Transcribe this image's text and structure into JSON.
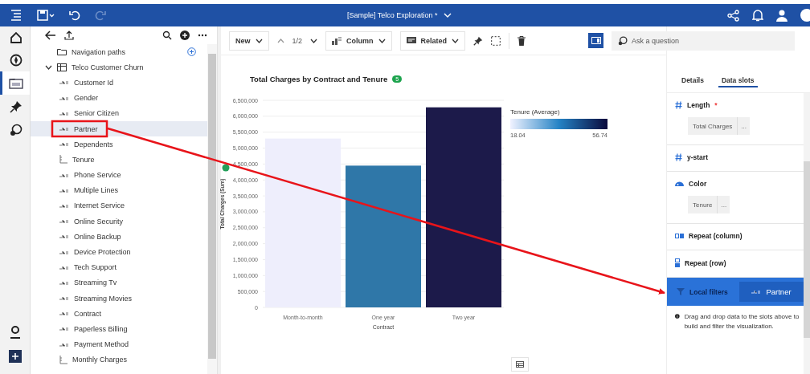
{
  "top_bar": {
    "title": "[Sample] Telco Exploration *"
  },
  "rail": [
    {
      "kind": "home",
      "selected": false
    },
    {
      "kind": "explore",
      "selected": false
    },
    {
      "kind": "data",
      "selected": true
    },
    {
      "kind": "pin",
      "selected": false
    },
    {
      "kind": "assistant",
      "selected": false
    }
  ],
  "tree": {
    "items": [
      {
        "label": "Navigation paths",
        "kind": "folder",
        "selected": false
      },
      {
        "label": "Telco Customer Churn",
        "kind": "table",
        "expanded": true,
        "selected": false,
        "children": [
          {
            "label": "Customer Id",
            "kind": "text",
            "selected": false
          },
          {
            "label": "Gender",
            "kind": "text",
            "selected": false
          },
          {
            "label": "Senior Citizen",
            "kind": "text",
            "selected": false
          },
          {
            "label": "Partner",
            "kind": "text",
            "selected": true
          },
          {
            "label": "Dependents",
            "kind": "text",
            "selected": false
          },
          {
            "label": "Tenure",
            "kind": "measure",
            "selected": false
          },
          {
            "label": "Phone Service",
            "kind": "text",
            "selected": false
          },
          {
            "label": "Multiple Lines",
            "kind": "text",
            "selected": false
          },
          {
            "label": "Internet Service",
            "kind": "text",
            "selected": false
          },
          {
            "label": "Online Security",
            "kind": "text",
            "selected": false
          },
          {
            "label": "Online Backup",
            "kind": "text",
            "selected": false
          },
          {
            "label": "Device Protection",
            "kind": "text",
            "selected": false
          },
          {
            "label": "Tech Support",
            "kind": "text",
            "selected": false
          },
          {
            "label": "Streaming Tv",
            "kind": "text",
            "selected": false
          },
          {
            "label": "Streaming Movies",
            "kind": "text",
            "selected": false
          },
          {
            "label": "Contract",
            "kind": "text",
            "selected": false
          },
          {
            "label": "Paperless Billing",
            "kind": "text",
            "selected": false
          },
          {
            "label": "Payment Method",
            "kind": "text",
            "selected": false
          },
          {
            "label": "Monthly Charges",
            "kind": "measure",
            "selected": false
          }
        ]
      }
    ]
  },
  "toolbar": {
    "new": "New",
    "page": "1/2",
    "visualization": "Column",
    "related": "Related",
    "ask": "Ask a question"
  },
  "chart": {
    "title": "Total Charges by Contract and Tenure",
    "badge": "5",
    "legend": {
      "title": "Tenure (Average)",
      "min": "18.04",
      "max": "56.74"
    },
    "chart_data": {
      "type": "bar",
      "xlabel": "Contract",
      "ylabel": "Total Charges (Sum)",
      "categories": [
        "Month-to-month",
        "One year",
        "Two year"
      ],
      "values": [
        5300000,
        4450000,
        6280000
      ],
      "grid": true,
      "ylim": [
        0,
        6500000
      ],
      "yticks": [
        {
          "value": 0,
          "label": "0"
        },
        {
          "value": 500000,
          "label": "500,000"
        },
        {
          "value": 1000000,
          "label": "1,000,000"
        },
        {
          "value": 1500000,
          "label": "1,500,000"
        },
        {
          "value": 2000000,
          "label": "2,000,000"
        },
        {
          "value": 2500000,
          "label": "2,500,000"
        },
        {
          "value": 3000000,
          "label": "3,000,000"
        },
        {
          "value": 3500000,
          "label": "3,500,000"
        },
        {
          "value": 4000000,
          "label": "4,000,000"
        },
        {
          "value": 4500000,
          "label": "4,500,000"
        },
        {
          "value": 5000000,
          "label": "5,000,000"
        },
        {
          "value": 5500000,
          "label": "5,500,000"
        },
        {
          "value": 6000000,
          "label": "6,000,000"
        },
        {
          "value": 6500000,
          "label": "6,500,000"
        }
      ]
    }
  },
  "panel": {
    "tabs": [
      {
        "label": "Details",
        "selected": false
      },
      {
        "label": "Data slots",
        "selected": true
      }
    ],
    "slots": [
      {
        "kind": "measure",
        "label": "Length",
        "required": "*",
        "chip": "Total Charges",
        "chip_more": "..."
      },
      {
        "kind": "measure",
        "label": "y-start"
      },
      {
        "kind": "color",
        "label": "Color",
        "chip": "Tenure",
        "chip_more": "..."
      },
      {
        "kind": "column",
        "label": "Repeat (column)"
      },
      {
        "kind": "row",
        "label": "Repeat (row)"
      },
      {
        "kind": "filter",
        "label": "Local filters",
        "chip": "Partner",
        "highlighted": true
      }
    ],
    "info": "Drag and drop data to the slots above to build and filter the visualization."
  }
}
